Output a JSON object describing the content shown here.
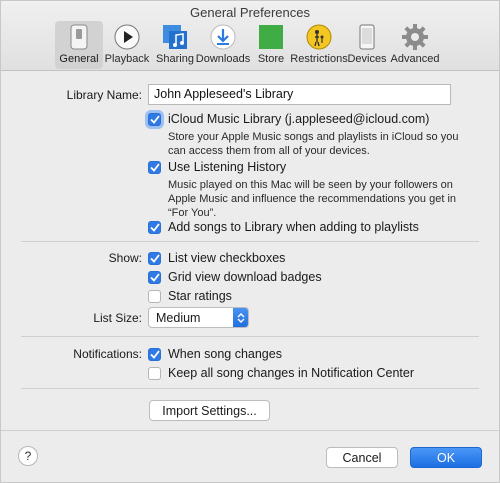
{
  "window": {
    "title": "General Preferences"
  },
  "toolbar": {
    "items": [
      {
        "label": "General",
        "icon": "general-switch-icon",
        "selected": true
      },
      {
        "label": "Playback",
        "icon": "play-icon"
      },
      {
        "label": "Sharing",
        "icon": "music-sharing-icon"
      },
      {
        "label": "Downloads",
        "icon": "download-icon"
      },
      {
        "label": "Store",
        "icon": "store-icon"
      },
      {
        "label": "Restrictions",
        "icon": "parental-icon"
      },
      {
        "label": "Devices",
        "icon": "phone-icon"
      },
      {
        "label": "Advanced",
        "icon": "gear-icon"
      }
    ]
  },
  "library": {
    "name_label": "Library Name:",
    "name_value": "John Appleseed's Library",
    "icloud_label": "iCloud Music Library (j.appleseed@icloud.com)",
    "icloud_checked": true,
    "icloud_help": [
      "Store your Apple Music songs and playlists in iCloud so you",
      "can access them from all of your devices."
    ],
    "history_label": "Use Listening History",
    "history_checked": true,
    "history_help": [
      "Music played on this Mac will be seen by your followers on",
      "Apple Music and influence the recommendations you get in",
      "“For You”."
    ],
    "add_songs_label": "Add songs to Library when adding to playlists",
    "add_songs_checked": true
  },
  "show": {
    "label": "Show:",
    "list_checkboxes_label": "List view checkboxes",
    "list_checkboxes_checked": true,
    "grid_badges_label": "Grid view download badges",
    "grid_badges_checked": true,
    "star_ratings_label": "Star ratings",
    "star_ratings_checked": false
  },
  "list_size": {
    "label": "List Size:",
    "value": "Medium"
  },
  "notifications": {
    "label": "Notifications:",
    "song_changes_label": "When song changes",
    "song_changes_checked": true,
    "keep_all_label": "Keep all song changes in Notification Center",
    "keep_all_checked": false
  },
  "buttons": {
    "import": "Import Settings...",
    "cancel": "Cancel",
    "ok": "OK",
    "help": "?"
  },
  "colors": {
    "accent": "#2f7ae5",
    "window_bg": "#ececec"
  }
}
